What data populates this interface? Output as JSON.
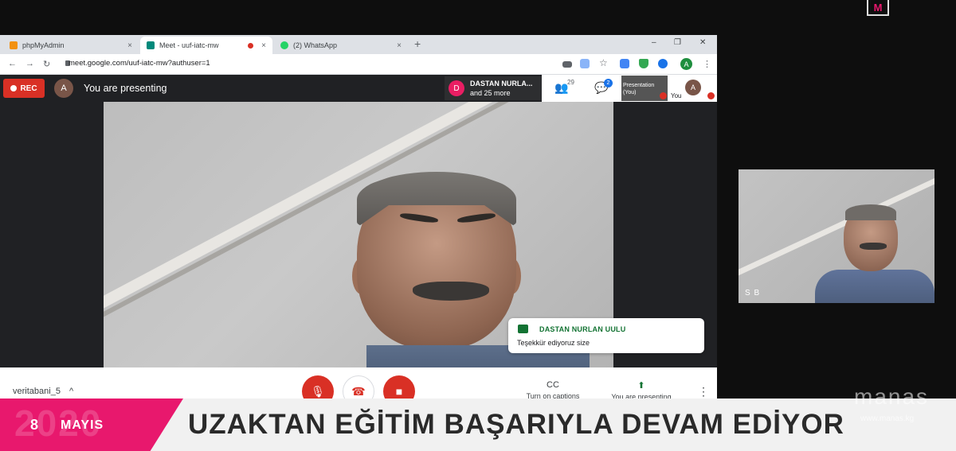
{
  "broadcast": {
    "logo": "M"
  },
  "browser": {
    "tabs": [
      {
        "label": "phpMyAdmin",
        "close": "×",
        "favicon_color": "#f29111"
      },
      {
        "label": "Meet - uuf-iatc-mw",
        "close": "×",
        "favicon_color": "#00897b"
      },
      {
        "label": "(2) WhatsApp",
        "close": "×",
        "favicon_color": "#25d366"
      }
    ],
    "new_tab": "+",
    "window_controls": {
      "minimize": "–",
      "restore": "❐",
      "close": "✕"
    },
    "nav": {
      "back": "←",
      "forward": "→",
      "reload": "↻"
    },
    "url": "meet.google.com/uuf-iatc-mw?authuser=1",
    "profile_initial": "A",
    "more": "⋮"
  },
  "meet": {
    "rec_label": "REC",
    "presenter_initial": "A",
    "presenting_status": "You are presenting",
    "participant_chip": {
      "initial": "D",
      "name": "DASTAN NURLA...",
      "more": "and 25 more"
    },
    "people_count": "29",
    "chat_count": "2",
    "presentation_tile": "Presentation (You)",
    "you_label": "You",
    "you_initial": "A",
    "chat_popup": {
      "sender": "DASTAN NURLAN UULU",
      "message": "Teşekkür ediyoruz size"
    },
    "meeting_name": "veritabani_5",
    "meeting_name_caret": "^",
    "controls": {
      "mic": "🎙",
      "hangup": "☎",
      "camera": "■",
      "captions_label": "Turn on captions",
      "captions_icon": "CC",
      "present_label": "You are presenting",
      "present_icon": "⬆",
      "more": "⋮"
    },
    "thumbnail_label": "S B"
  },
  "banner": {
    "year": "2020",
    "day": "8",
    "month": "MAYIS",
    "headline": "UZAKTAN EĞİTİM BAŞARIYLA DEVAM EDİYOR",
    "brand": "manas",
    "site": "www.manas.kg"
  },
  "colors": {
    "accent_pink": "#e8186d",
    "meet_red": "#d93025",
    "meet_green": "#137333"
  }
}
